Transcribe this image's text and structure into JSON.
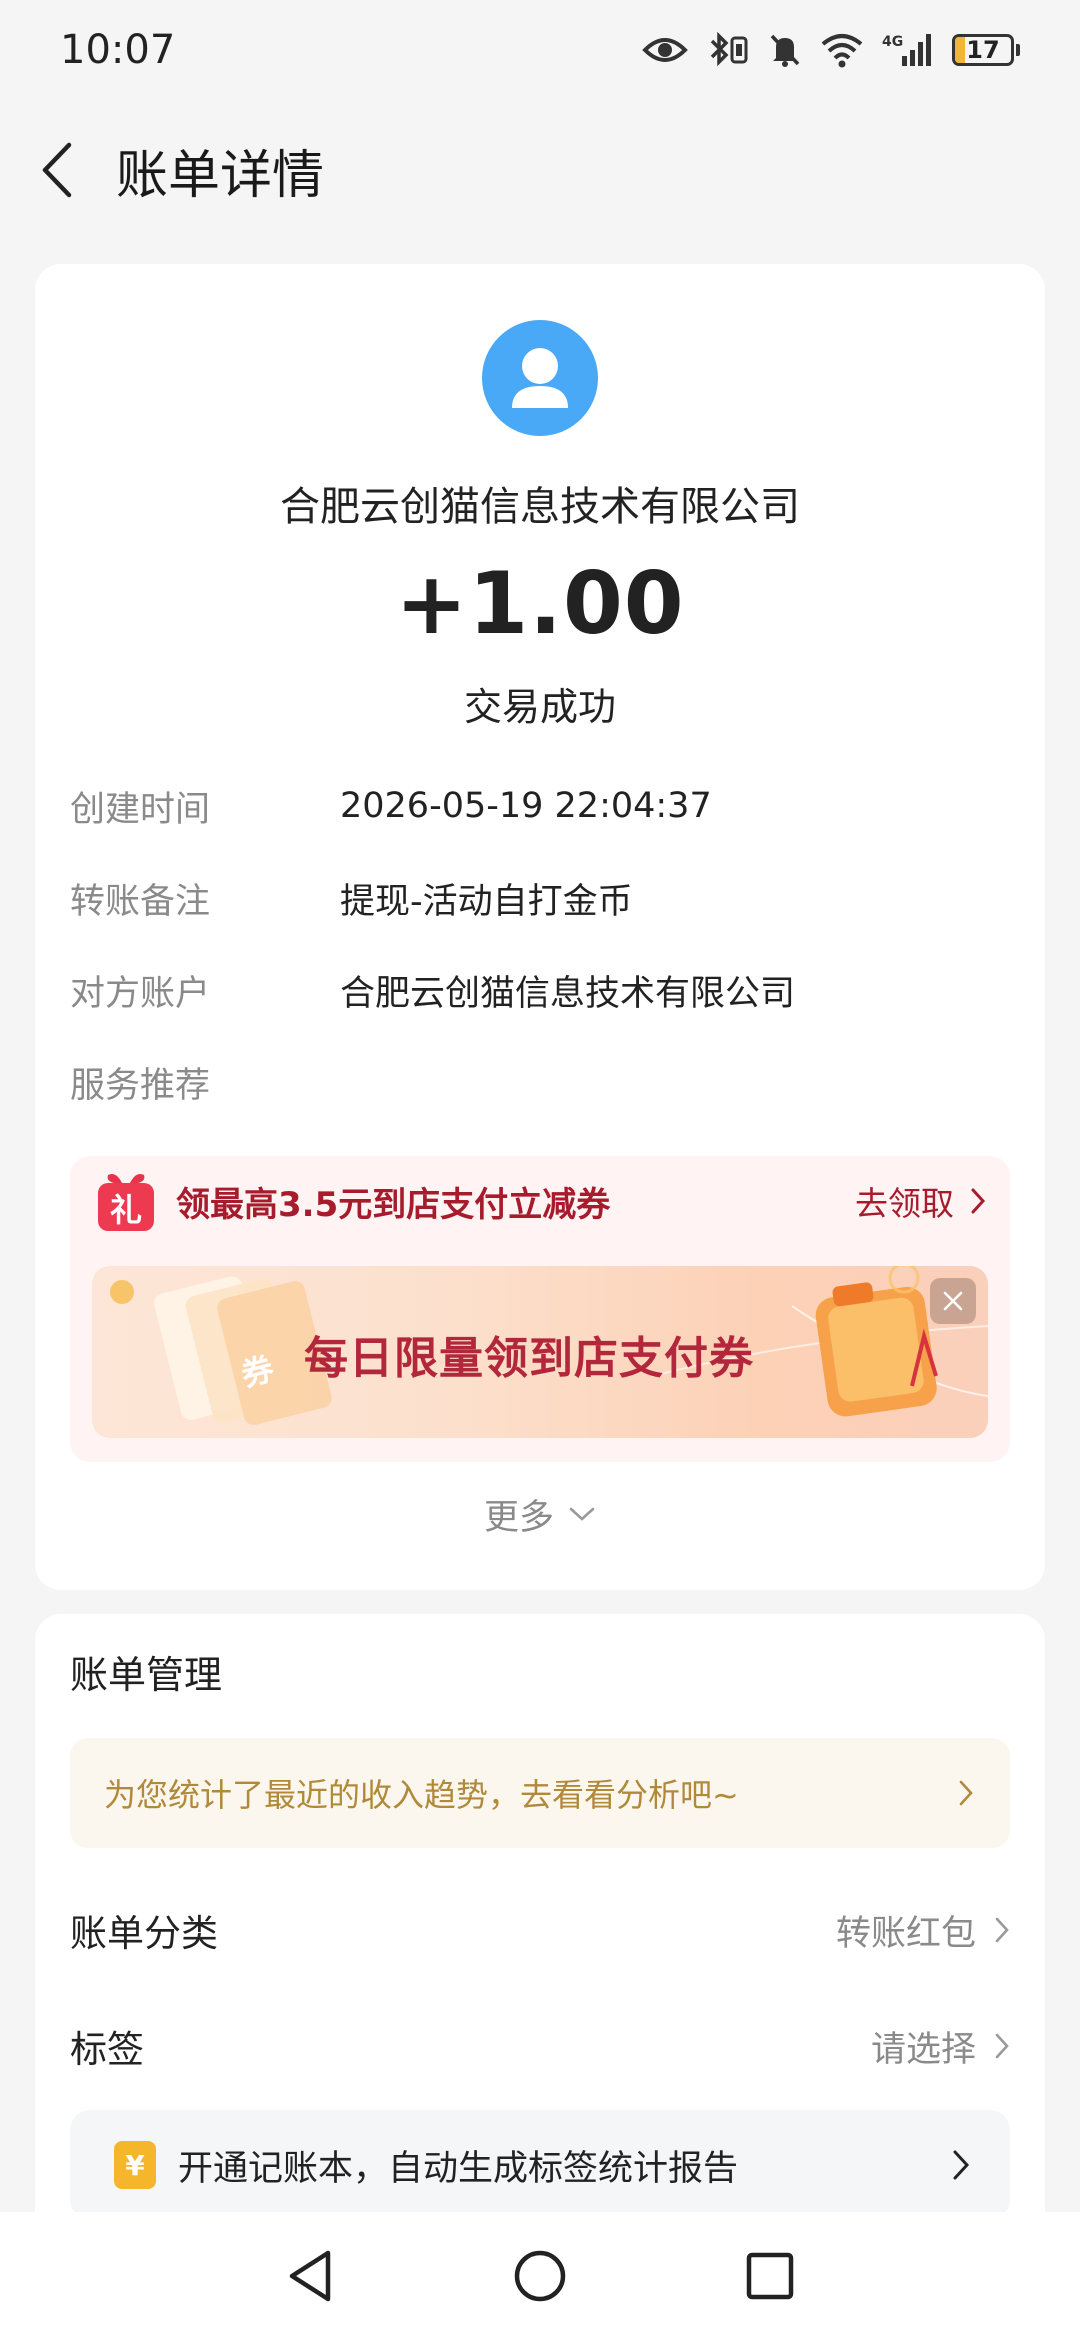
{
  "status_bar": {
    "time": "10:07",
    "battery_level": "17",
    "battery_fraction": 0.17,
    "icons": [
      "eye-icon",
      "bluetooth-icon",
      "mute-icon",
      "wifi-icon",
      "signal-4g-icon",
      "battery-icon"
    ],
    "network_label": "4G"
  },
  "header": {
    "title": "账单详情",
    "back_icon": "chevron-left-icon"
  },
  "transaction": {
    "payer": "合肥云创猫信息技术有限公司",
    "amount": "+1.00",
    "status": "交易成功"
  },
  "details": [
    {
      "label": "创建时间",
      "value": "2026-05-19 22:04:37"
    },
    {
      "label": "转账备注",
      "value": "提现-活动自打金币"
    },
    {
      "label": "对方账户",
      "value": "合肥云创猫信息技术有限公司"
    },
    {
      "label": "服务推荐",
      "value": ""
    }
  ],
  "promo": {
    "gift_icon_char": "礼",
    "title": "领最高3.5元到店支付立减券",
    "action": "去领取",
    "banner_text": "每日限量领到店支付券",
    "banner_ticket_char": "券"
  },
  "more": {
    "label": "更多"
  },
  "manage": {
    "title": "账单管理",
    "trend_text": "为您统计了最近的收入趋势，去看看分析吧~",
    "category_label": "账单分类",
    "category_value": "转账红包",
    "tag_label": "标签",
    "tag_value": "请选择",
    "ledger_icon_char": "¥",
    "ledger_text": "开通记账本，自动生成标签统计报告"
  },
  "colors": {
    "accent_blue": "#4aa9f6",
    "promo_red": "#a61c2c",
    "trend_gold": "#b08a3a",
    "ledger_icon": "#f6b62c"
  }
}
